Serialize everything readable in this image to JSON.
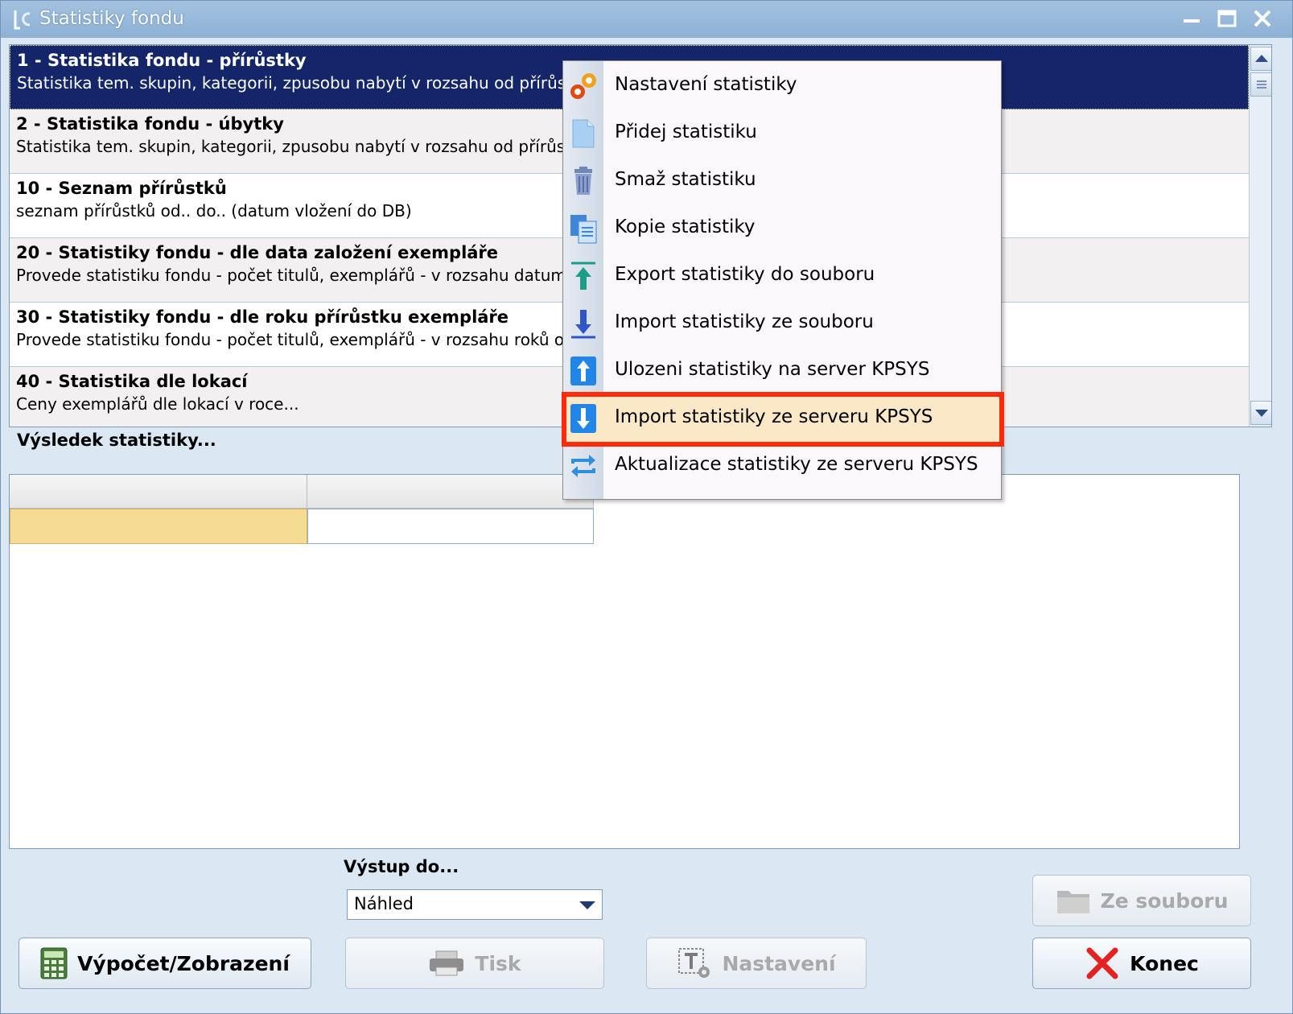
{
  "window": {
    "title": "Statistiky fondu"
  },
  "stat_list": {
    "items": [
      {
        "title": "1 - Statistika fondu - přírůstky",
        "desc": "Statistika tem. skupin, kategorii, zpusobu nabytí v rozsahu  od přírůstku"
      },
      {
        "title": "2 - Statistika fondu - úbytky",
        "desc": "Statistika tem. skupin, kategorii, zpusobu nabytí v rozsahu  od přírůstku"
      },
      {
        "title": "10 - Seznam přírůstků",
        "desc": "seznam přírůstků od.. do.. (datum vložení do DB)"
      },
      {
        "title": "20 - Statistiky fondu - dle data založení exempláře",
        "desc": "Provede statistiku fondu - počet titulů, exemplářů - v rozsahu datumů d"
      },
      {
        "title": "30 - Statistiky fondu - dle roku přírůstku exempláře",
        "desc": "Provede statistiku fondu - počet titulů, exemplářů - v rozsahu roků od ."
      },
      {
        "title": "40 - Statistika  dle lokací",
        "desc": "Ceny exemplářů dle lokací v roce..."
      }
    ]
  },
  "context_menu": {
    "items": [
      {
        "label": "Nastavení statistiky",
        "icon": "gears-icon"
      },
      {
        "label": "Přidej statistiku",
        "icon": "new-document-icon"
      },
      {
        "label": "Smaž statistiku",
        "icon": "trash-icon"
      },
      {
        "label": "Kopie statistiky",
        "icon": "copy-icon"
      },
      {
        "label": "Export statistiky do souboru",
        "icon": "export-icon"
      },
      {
        "label": "Import statistiky ze souboru",
        "icon": "import-icon"
      },
      {
        "label": "Ulozeni statistiky na server KPSYS",
        "icon": "upload-icon"
      },
      {
        "label": "Import statistiky ze serveru KPSYS",
        "icon": "download-icon"
      },
      {
        "label": "Aktualizace statistiky ze serveru KPSYS",
        "icon": "refresh-icon"
      }
    ],
    "highlighted_index": 7
  },
  "result": {
    "label": "Výsledek statistiky..."
  },
  "output": {
    "label": "Výstup do...",
    "selected": "Náhled"
  },
  "buttons": {
    "compute": "Výpočet/Zobrazení",
    "print": "Tisk",
    "settings": "Nastavení",
    "from_file": "Ze souboru",
    "close": "Konec"
  },
  "colors": {
    "selection": "#14256a",
    "highlight_frame": "#ff2a0a",
    "menu_hover": "#fbe8c6",
    "grid_selected_cell": "#f6dc92"
  }
}
